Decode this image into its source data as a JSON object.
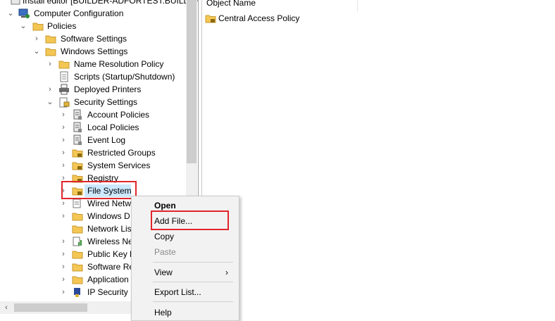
{
  "tree": {
    "title_text": "Install editor [BUILDER-ADFORTEST.BUILDER",
    "items": [
      {
        "label": "Computer Configuration",
        "icon": "computer-config-icon"
      },
      {
        "label": "Policies",
        "icon": "folder-icon"
      },
      {
        "label": "Software Settings",
        "icon": "folder-icon"
      },
      {
        "label": "Windows Settings",
        "icon": "folder-icon"
      },
      {
        "label": "Name Resolution Policy",
        "icon": "folder-icon"
      },
      {
        "label": "Scripts (Startup/Shutdown)",
        "icon": "script-icon"
      },
      {
        "label": "Deployed Printers",
        "icon": "printer-icon"
      },
      {
        "label": "Security Settings",
        "icon": "security-icon"
      },
      {
        "label": "Account Policies",
        "icon": "policy-icon"
      },
      {
        "label": "Local Policies",
        "icon": "policy-icon"
      },
      {
        "label": "Event Log",
        "icon": "policy-icon"
      },
      {
        "label": "Restricted Groups",
        "icon": "locked-folder-icon"
      },
      {
        "label": "System Services",
        "icon": "locked-folder-icon"
      },
      {
        "label": "Registry",
        "icon": "locked-folder-icon"
      },
      {
        "label": "File System",
        "icon": "locked-folder-icon"
      },
      {
        "label": "Wired Netw",
        "icon": "network-icon"
      },
      {
        "label": "Windows D",
        "icon": "folder-icon"
      },
      {
        "label": "Network Lis",
        "icon": "folder-icon"
      },
      {
        "label": "Wireless Ne",
        "icon": "wireless-icon"
      },
      {
        "label": "Public Key P",
        "icon": "folder-icon"
      },
      {
        "label": "Software Re",
        "icon": "folder-icon"
      },
      {
        "label": "Application",
        "icon": "folder-icon"
      },
      {
        "label": "IP Security P",
        "icon": "ipsec-icon"
      }
    ]
  },
  "details": {
    "column_header": "Object Name",
    "rows": [
      {
        "label": "Central Access Policy",
        "icon": "locked-folder-icon"
      }
    ]
  },
  "context_menu": {
    "items": [
      {
        "label": "Open",
        "bold": true,
        "enabled": true
      },
      {
        "label": "Add File...",
        "bold": false,
        "enabled": true
      },
      {
        "label": "Copy",
        "bold": false,
        "enabled": true
      },
      {
        "label": "Paste",
        "bold": false,
        "enabled": false
      },
      {
        "label": "View",
        "bold": false,
        "enabled": true,
        "submenu": true
      },
      {
        "label": "Export List...",
        "bold": false,
        "enabled": true
      },
      {
        "label": "Help",
        "bold": false,
        "enabled": true
      }
    ]
  },
  "colors": {
    "highlight_outline": "#e0262b",
    "selection": "#cce8ff",
    "folder": "#f4c654"
  }
}
